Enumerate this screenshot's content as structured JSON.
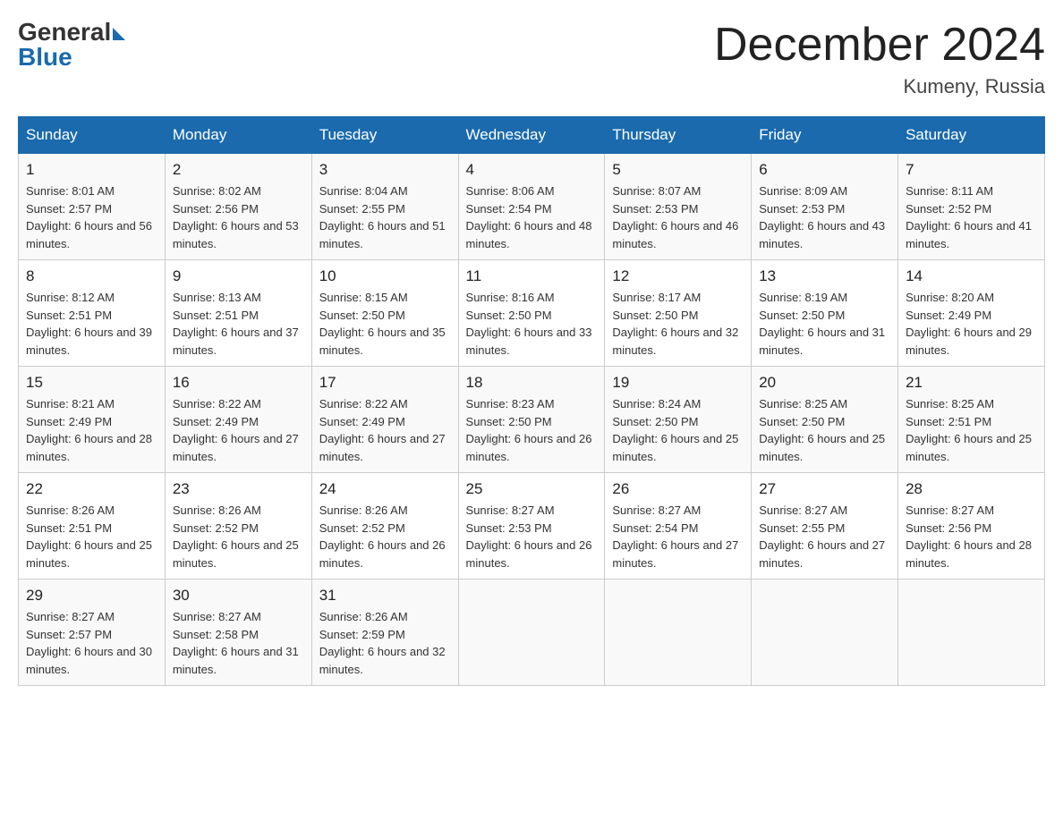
{
  "header": {
    "logo_general": "General",
    "logo_blue": "Blue",
    "month_title": "December 2024",
    "location": "Kumeny, Russia"
  },
  "weekdays": [
    "Sunday",
    "Monday",
    "Tuesday",
    "Wednesday",
    "Thursday",
    "Friday",
    "Saturday"
  ],
  "weeks": [
    [
      {
        "day": "1",
        "sunrise": "8:01 AM",
        "sunset": "2:57 PM",
        "daylight": "6 hours and 56 minutes."
      },
      {
        "day": "2",
        "sunrise": "8:02 AM",
        "sunset": "2:56 PM",
        "daylight": "6 hours and 53 minutes."
      },
      {
        "day": "3",
        "sunrise": "8:04 AM",
        "sunset": "2:55 PM",
        "daylight": "6 hours and 51 minutes."
      },
      {
        "day": "4",
        "sunrise": "8:06 AM",
        "sunset": "2:54 PM",
        "daylight": "6 hours and 48 minutes."
      },
      {
        "day": "5",
        "sunrise": "8:07 AM",
        "sunset": "2:53 PM",
        "daylight": "6 hours and 46 minutes."
      },
      {
        "day": "6",
        "sunrise": "8:09 AM",
        "sunset": "2:53 PM",
        "daylight": "6 hours and 43 minutes."
      },
      {
        "day": "7",
        "sunrise": "8:11 AM",
        "sunset": "2:52 PM",
        "daylight": "6 hours and 41 minutes."
      }
    ],
    [
      {
        "day": "8",
        "sunrise": "8:12 AM",
        "sunset": "2:51 PM",
        "daylight": "6 hours and 39 minutes."
      },
      {
        "day": "9",
        "sunrise": "8:13 AM",
        "sunset": "2:51 PM",
        "daylight": "6 hours and 37 minutes."
      },
      {
        "day": "10",
        "sunrise": "8:15 AM",
        "sunset": "2:50 PM",
        "daylight": "6 hours and 35 minutes."
      },
      {
        "day": "11",
        "sunrise": "8:16 AM",
        "sunset": "2:50 PM",
        "daylight": "6 hours and 33 minutes."
      },
      {
        "day": "12",
        "sunrise": "8:17 AM",
        "sunset": "2:50 PM",
        "daylight": "6 hours and 32 minutes."
      },
      {
        "day": "13",
        "sunrise": "8:19 AM",
        "sunset": "2:50 PM",
        "daylight": "6 hours and 31 minutes."
      },
      {
        "day": "14",
        "sunrise": "8:20 AM",
        "sunset": "2:49 PM",
        "daylight": "6 hours and 29 minutes."
      }
    ],
    [
      {
        "day": "15",
        "sunrise": "8:21 AM",
        "sunset": "2:49 PM",
        "daylight": "6 hours and 28 minutes."
      },
      {
        "day": "16",
        "sunrise": "8:22 AM",
        "sunset": "2:49 PM",
        "daylight": "6 hours and 27 minutes."
      },
      {
        "day": "17",
        "sunrise": "8:22 AM",
        "sunset": "2:49 PM",
        "daylight": "6 hours and 27 minutes."
      },
      {
        "day": "18",
        "sunrise": "8:23 AM",
        "sunset": "2:50 PM",
        "daylight": "6 hours and 26 minutes."
      },
      {
        "day": "19",
        "sunrise": "8:24 AM",
        "sunset": "2:50 PM",
        "daylight": "6 hours and 25 minutes."
      },
      {
        "day": "20",
        "sunrise": "8:25 AM",
        "sunset": "2:50 PM",
        "daylight": "6 hours and 25 minutes."
      },
      {
        "day": "21",
        "sunrise": "8:25 AM",
        "sunset": "2:51 PM",
        "daylight": "6 hours and 25 minutes."
      }
    ],
    [
      {
        "day": "22",
        "sunrise": "8:26 AM",
        "sunset": "2:51 PM",
        "daylight": "6 hours and 25 minutes."
      },
      {
        "day": "23",
        "sunrise": "8:26 AM",
        "sunset": "2:52 PM",
        "daylight": "6 hours and 25 minutes."
      },
      {
        "day": "24",
        "sunrise": "8:26 AM",
        "sunset": "2:52 PM",
        "daylight": "6 hours and 26 minutes."
      },
      {
        "day": "25",
        "sunrise": "8:27 AM",
        "sunset": "2:53 PM",
        "daylight": "6 hours and 26 minutes."
      },
      {
        "day": "26",
        "sunrise": "8:27 AM",
        "sunset": "2:54 PM",
        "daylight": "6 hours and 27 minutes."
      },
      {
        "day": "27",
        "sunrise": "8:27 AM",
        "sunset": "2:55 PM",
        "daylight": "6 hours and 27 minutes."
      },
      {
        "day": "28",
        "sunrise": "8:27 AM",
        "sunset": "2:56 PM",
        "daylight": "6 hours and 28 minutes."
      }
    ],
    [
      {
        "day": "29",
        "sunrise": "8:27 AM",
        "sunset": "2:57 PM",
        "daylight": "6 hours and 30 minutes."
      },
      {
        "day": "30",
        "sunrise": "8:27 AM",
        "sunset": "2:58 PM",
        "daylight": "6 hours and 31 minutes."
      },
      {
        "day": "31",
        "sunrise": "8:26 AM",
        "sunset": "2:59 PM",
        "daylight": "6 hours and 32 minutes."
      },
      null,
      null,
      null,
      null
    ]
  ]
}
